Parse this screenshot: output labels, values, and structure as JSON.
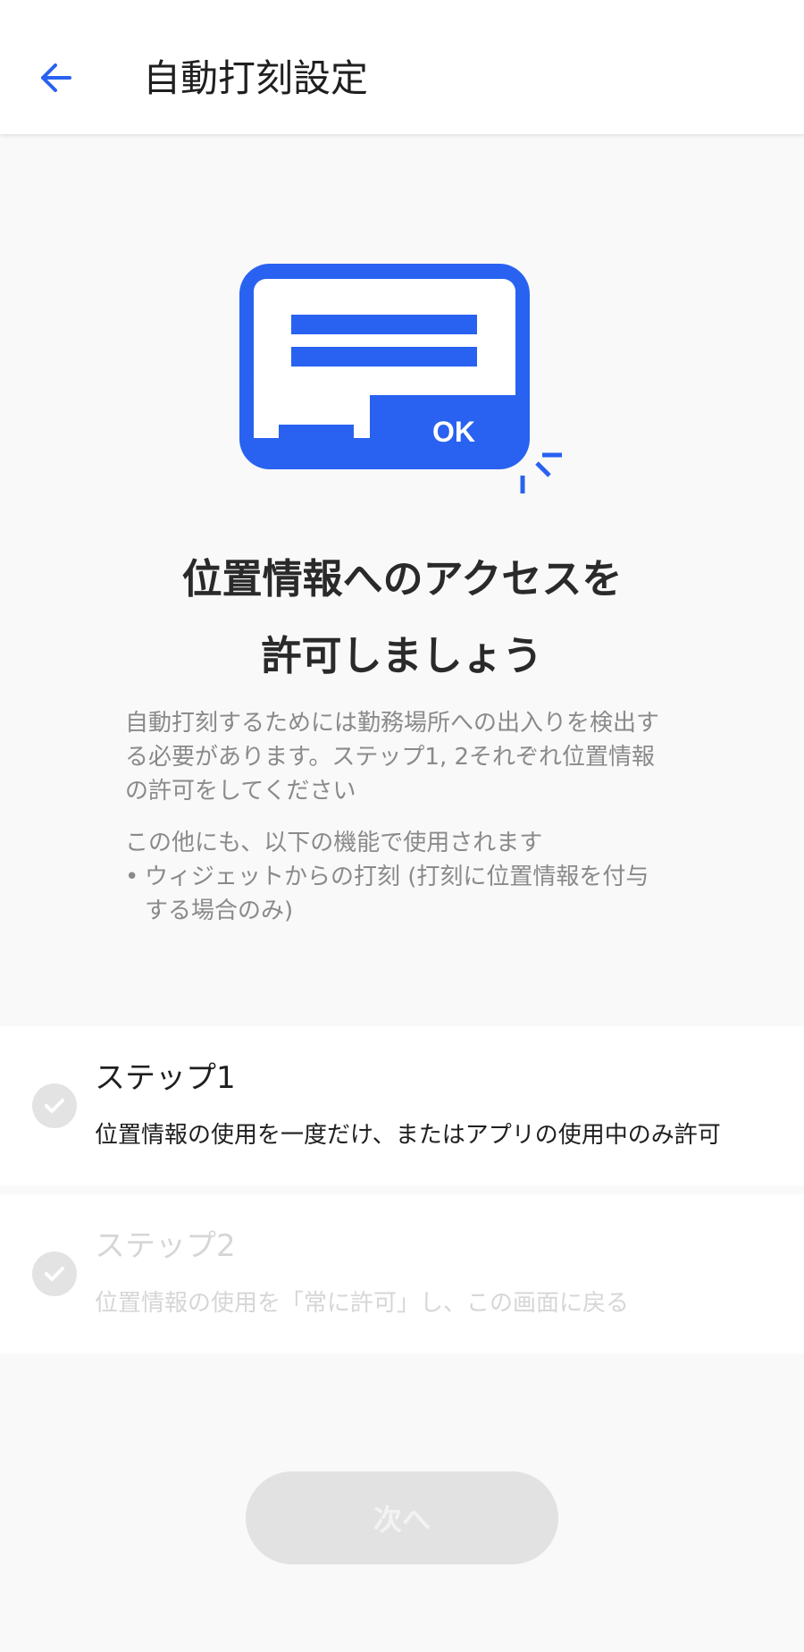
{
  "header": {
    "back_icon": "arrow-left-icon",
    "title": "自動打刻設定"
  },
  "hero": {
    "illustration_icon": "dialog-ok-icon",
    "ok_label": "OK"
  },
  "headline": {
    "line1": "位置情報へのアクセスを",
    "line2": "許可しましょう"
  },
  "description": {
    "paragraph1_line1": "自動打刻するためには勤務場所への出入りを検出す",
    "paragraph1_line2": "る必要があります。ステップ1, 2それぞれ位置情報",
    "paragraph1_line3": "の許可をしてください",
    "paragraph2": "この他にも、以下の機能で使用されます",
    "bullet_mark": "•",
    "bullet_line1": "ウィジェットからの打刻 (打刻に位置情報を付与",
    "bullet_line2": "する場合のみ)"
  },
  "steps": [
    {
      "title": "ステップ1",
      "body": "位置情報の使用を一度だけ、またはアプリの使用中のみ許可",
      "icon": "check-icon"
    },
    {
      "title": "ステップ2",
      "body": "位置情報の使用を「常に許可」し、この画面に戻る",
      "icon": "check-icon"
    }
  ],
  "next_button": {
    "label": "次へ"
  },
  "colors": {
    "accent": "#2962f0",
    "background": "#f9f9f9",
    "disabled": "#e2e2e2"
  }
}
